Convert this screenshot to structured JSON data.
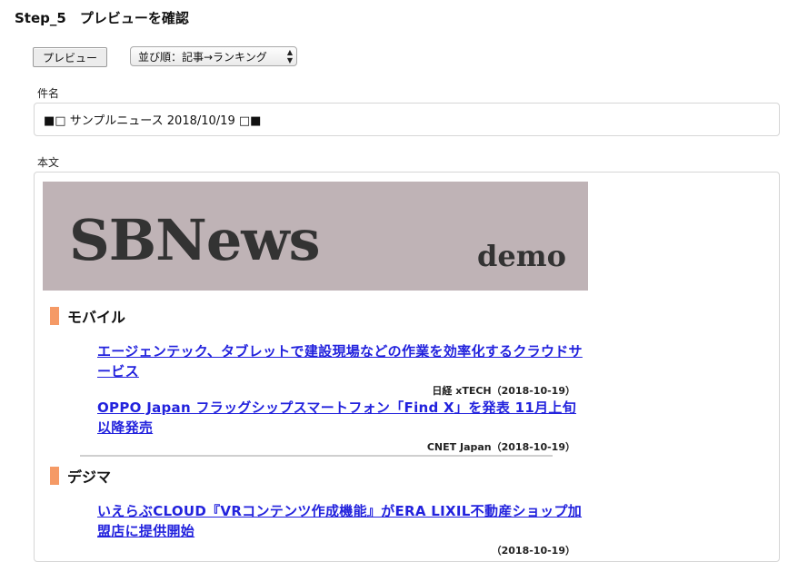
{
  "page": {
    "step_title": "Step_5　プレビューを確認"
  },
  "controls": {
    "preview_label": "プレビュー",
    "sort_value": "並び順：記事→ランキング"
  },
  "subject": {
    "label": "件名",
    "value": "■□ サンプルニュース 2018/10/19 □■"
  },
  "body": {
    "label": "本文",
    "banner": {
      "logo": "SBNews",
      "subtitle": "demo"
    },
    "sections": [
      {
        "title": "モバイル",
        "articles": [
          {
            "title": "エージェンテック、タブレットで建設現場などの作業を効率化するクラウドサービス",
            "source": "日経 xTECH（2018-10-19）"
          },
          {
            "title": "OPPO Japan フラッグシップスマートフォン「Find X」を発表 11月上旬以降発売",
            "source": "CNET Japan（2018-10-19）"
          }
        ]
      },
      {
        "title": "デジマ",
        "articles": [
          {
            "title": "いえらぶCLOUD『VRコンテンツ作成機能』がERA LIXIL不動産ショップ加盟店に提供開始",
            "source": "（2018-10-19）"
          }
        ]
      }
    ]
  },
  "colors": {
    "banner_bg": "#bfb3b6",
    "section_bar": "#f59a66",
    "link": "#2222dd"
  }
}
